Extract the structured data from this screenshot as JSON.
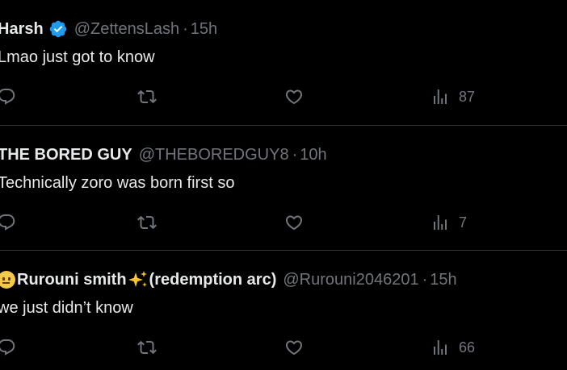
{
  "tweets": [
    {
      "name": "Harsh",
      "verified": true,
      "handle": "@ZettensLash",
      "separator": "·",
      "time": "15h",
      "text": "Lmao just got to know",
      "views": "87"
    },
    {
      "name": "THE BORED GUY",
      "verified": false,
      "handle": "@THEBOREDGUY8",
      "separator": "·",
      "time": "10h",
      "text": "Technically zoro was born first so",
      "views": "7"
    },
    {
      "name_prefix_emoji": "neutral-face-emoji",
      "name": "Rurouni smith",
      "name_emoji": "sparkles-emoji",
      "name_suffix": "(redemption arc)",
      "verified": false,
      "handle": "@Rurouni2046201",
      "separator": "·",
      "time": "15h",
      "text": "we just didn’t know",
      "views": "66"
    }
  ],
  "icons": {
    "reply": "reply-icon",
    "retweet": "retweet-icon",
    "like": "like-icon",
    "views": "views-icon",
    "verified": "verified-badge-icon"
  },
  "colors": {
    "background": "#000000",
    "text_primary": "#e7e9ea",
    "text_secondary": "#71767b",
    "divider": "#2f3336",
    "verified_blue": "#1d9bf0"
  }
}
